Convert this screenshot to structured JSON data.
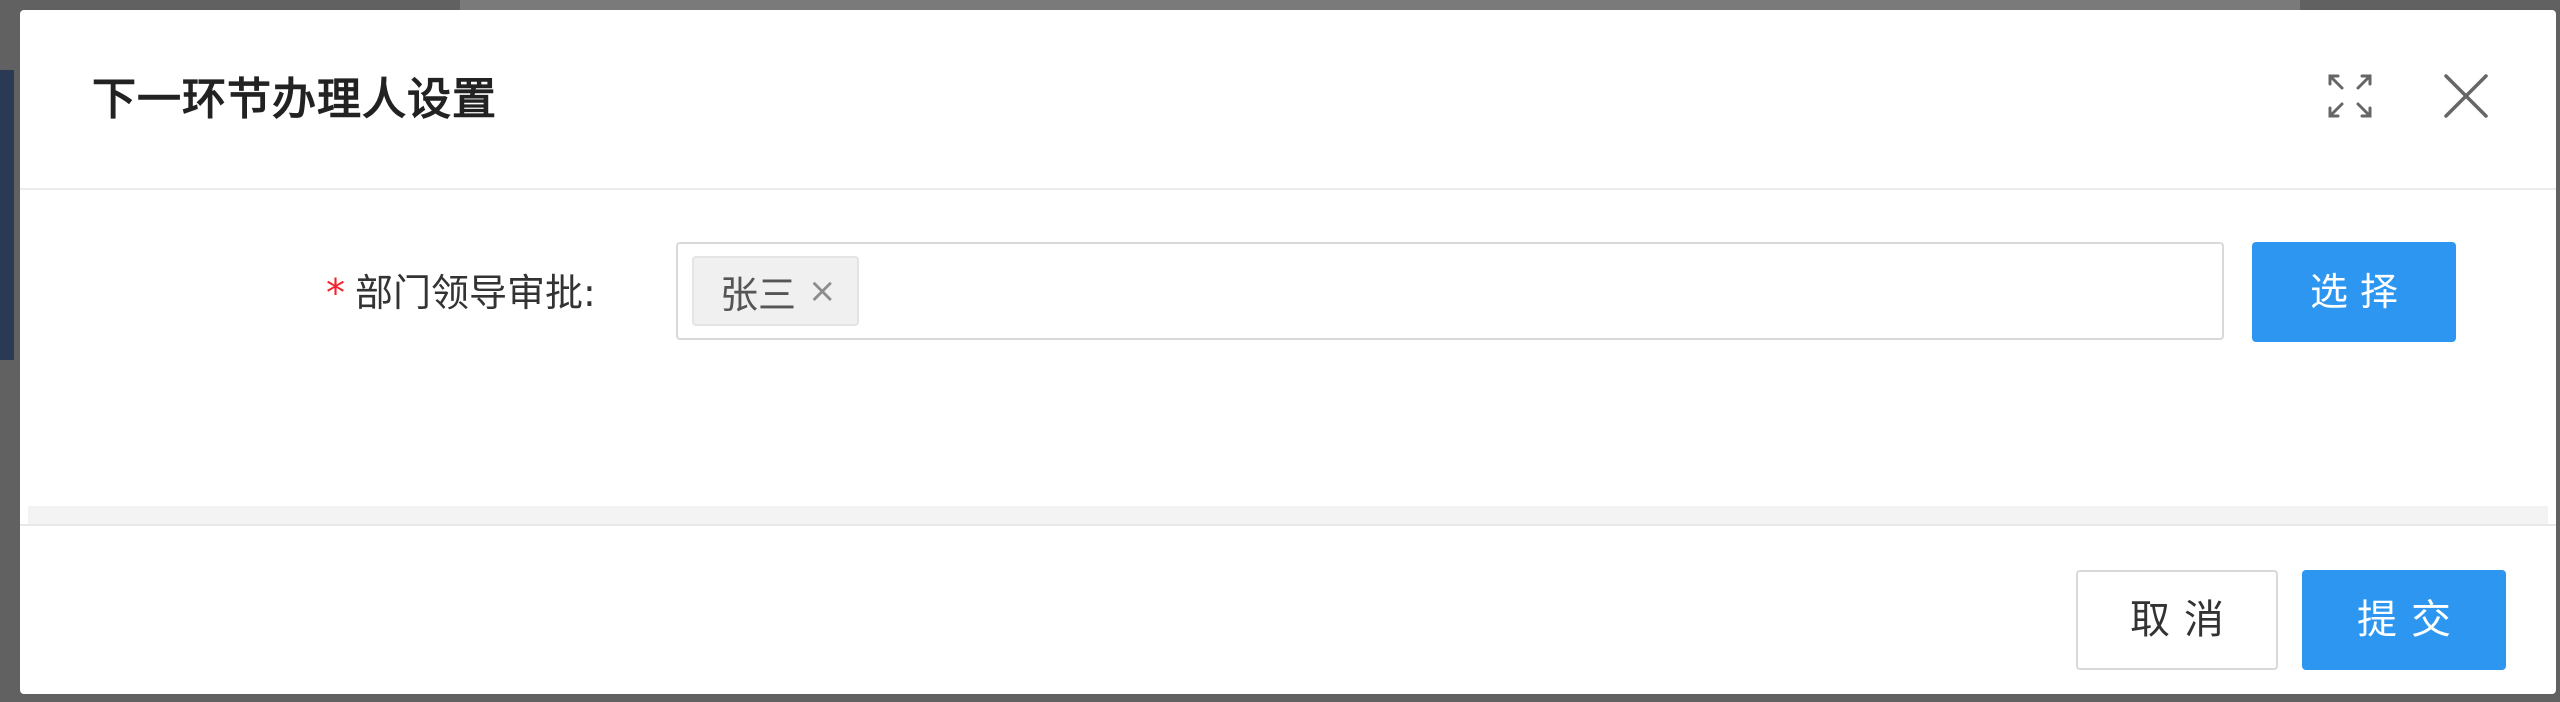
{
  "dialog": {
    "title": "下一环节办理人设置",
    "maximize_icon": "maximize-icon",
    "close_icon": "close-icon"
  },
  "form": {
    "field_label": "部门领导审批:",
    "required_mark": "*",
    "selected_tags": [
      {
        "label": "张三",
        "remove_symbol": "×"
      }
    ],
    "select_button_label": "选择"
  },
  "footer": {
    "cancel_label": "取消",
    "submit_label": "提交"
  },
  "colors": {
    "primary": "#2d96f0",
    "required": "#f5222d",
    "overlay": "#616161"
  }
}
